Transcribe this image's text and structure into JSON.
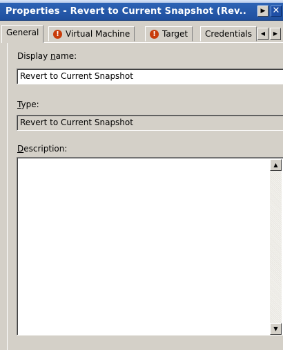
{
  "window": {
    "title": "Properties - Revert to Current Snapshot (Rev...",
    "arrow_glyph": "▶",
    "close_glyph": "✕"
  },
  "tabs": [
    {
      "label": "General",
      "warning": false,
      "active": true
    },
    {
      "label": "Virtual Machine",
      "warning": true,
      "active": false
    },
    {
      "label": "Target",
      "warning": true,
      "active": false
    },
    {
      "label": "Credentials",
      "warning": false,
      "active": false
    }
  ],
  "tab_scroll": {
    "left_glyph": "◀",
    "right_glyph": "▶"
  },
  "warning_glyph": "!",
  "form": {
    "display_name": {
      "label_pre": "Display ",
      "label_accel": "n",
      "label_post": "ame:",
      "value": "Revert to Current Snapshot"
    },
    "type": {
      "label_accel": "T",
      "label_post": "ype:",
      "value": "Revert to Current Snapshot"
    },
    "description": {
      "label_accel": "D",
      "label_post": "escription:",
      "value": "",
      "scroll_up_glyph": "▲",
      "scroll_down_glyph": "▼"
    }
  }
}
